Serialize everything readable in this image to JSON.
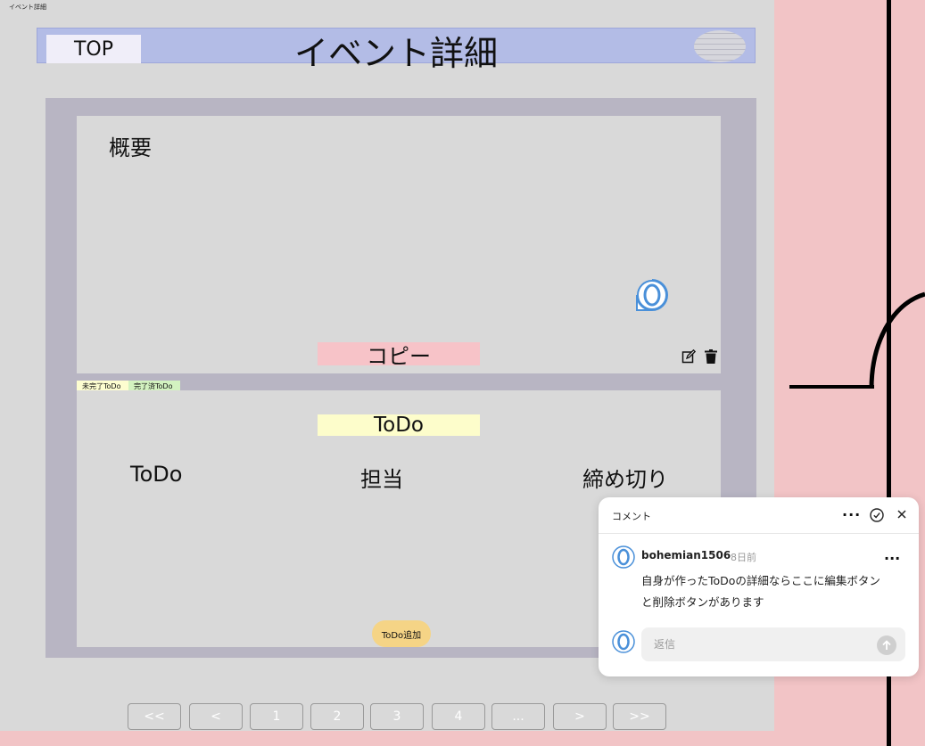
{
  "frame_label": "イベント詳細",
  "header": {
    "top_button": "TOP",
    "title": "イベント詳細"
  },
  "overview": {
    "title": "概要",
    "copy_button": "コピー"
  },
  "tabs": {
    "incomplete": "未完了ToDo",
    "complete": "完了済ToDo"
  },
  "todo": {
    "label": "ToDo",
    "columns": [
      "ToDo",
      "担当",
      "締め切り"
    ],
    "add_button": "ToDo追加"
  },
  "pagination": [
    "<<",
    "<",
    "1",
    "2",
    "3",
    "4",
    "...",
    ">",
    ">>"
  ],
  "comment_panel": {
    "title": "コメント",
    "more": "···",
    "author": "bohemian1506",
    "time": "8日前",
    "text": "自身が作ったToDoの詳細ならここに編集ボタンと削除ボタンがあります",
    "reply_placeholder": "返信"
  },
  "colors": {
    "header_bg": "#b3bce6",
    "copy_bg": "#f7c3c8",
    "todo_label_bg": "#fdfdcb",
    "add_bg": "#f5d486",
    "canvas_bg": "#f2c4c6",
    "avatar_accent": "#4a90d9"
  },
  "icons": {
    "edit": "edit-icon",
    "trash": "trash-icon",
    "resolve": "check-circle-icon",
    "close": "close-icon",
    "send": "send-arrow-icon"
  }
}
